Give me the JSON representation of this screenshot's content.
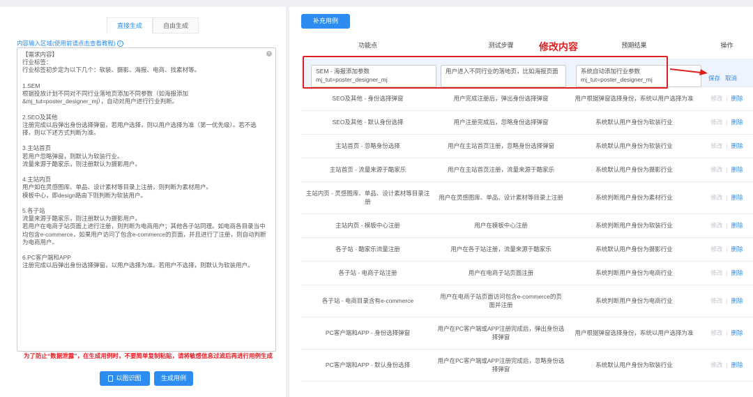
{
  "left": {
    "tabs": [
      "直接生成",
      "自由生成"
    ],
    "hint": "内容输入区域(使用前请点击查看教程)",
    "lines": [
      "【需求内容】",
      "行业标签：",
      "行业标签初步定为以下几个：软装、摄影、海报、电商、找素材等。",
      "",
      "1.SEM",
      "根据投放计划不同对不同行业落地页添加不同参数（如海报添加",
      "&mj_tut=poster_designer_mj），自动对用户进行行业判断。",
      "",
      "2.SEO及其他",
      "注册完成以后弹出身份选择弹窗，若用户选择，则以用户选择为准（第一优先级）。若不选",
      "择，则以下述方式判断为准。",
      "",
      "3.主站首页",
      "若用户忽略弹窗，则默认为软装行业。",
      "流量来源于酷家乐，则注册默认为摄影用户。",
      "",
      "4.主站内页",
      "用户如在灵感图库、单品、设计素材等目录上注册，则判断为素材用户。",
      "模板中心，即design路由下则判断为软装用户。",
      "",
      "5.各子站",
      "流量来源于酷家乐，则注册默认为摄影用户。",
      "若用户在电商子站页面上进行注册，则判断为电商用户；其他各子站同理。如电商各目录当中",
      "均包含e-commerce，如果用户访问了包含e-commerce的页面，并且进行了注册，则自动判断",
      "为电商用户。",
      "",
      "6.PC客户端和APP",
      "注册完成以后弹出身份选择弹窗，以用户选择为准。若用户不选择，则默认为软装用户。"
    ],
    "warning": "为了防止“数据泄露”，在生成用例时，不要简单复制粘贴，请将敏感信息过滤后再进行用例生成",
    "preview_button": "以图识图",
    "generate_button": "生成用例"
  },
  "right": {
    "add_button": "补充用例",
    "headers": [
      "功能点",
      "测试步骤",
      "预期结果",
      "操作"
    ],
    "annotation": "修改内容",
    "edit_row": {
      "feature": "SEM - 海报添加参数 mj_tut=poster_designer_mj",
      "steps": "用户进入不同行业的落地页，比如海报页面",
      "expected": "系统自动添加行业参数 mj_tut=poster_designer_mj",
      "save": "保存",
      "cancel": "取消"
    },
    "op_edit": "修改",
    "op_sep": "|",
    "op_delete": "删除",
    "rows": [
      {
        "feature": "SEO及其他 - 身份选择弹窗",
        "steps": "用户完成注册后，弹出身份选择弹窗",
        "expected": "用户根据弹窗选择身份，系统以用户选择为准"
      },
      {
        "feature": "SEO及其他 - 默认身份选择",
        "steps": "用户注册完成后，忽略身份选择弹窗",
        "expected": "系统默认用户身份为软装行业"
      },
      {
        "feature": "主站首页 - 忽略身份选择",
        "steps": "用户在主站首页注册，忽略身份选择弹窗",
        "expected": "系统默认用户身份为软装行业"
      },
      {
        "feature": "主站首页 - 流量来源于酷家乐",
        "steps": "用户在主站首页注册，流量来源于酷家乐",
        "expected": "系统默认用户身份为摄影行业"
      },
      {
        "feature": "主站内页 - 灵感图库、单品、设计素材等目录注册",
        "steps": "用户在灵感图库、单品、设计素材等目录上注册",
        "expected": "系统判断用户身份为素材行业"
      },
      {
        "feature": "主站内页 - 模板中心注册",
        "steps": "用户在模板中心注册",
        "expected": "系统判断用户身份为软装行业"
      },
      {
        "feature": "各子站 - 酷家乐流量注册",
        "steps": "用户在各子站注册，流量来源于酷家乐",
        "expected": "系统默认用户身份为摄影行业"
      },
      {
        "feature": "各子站 - 电商子站注册",
        "steps": "用户在电商子站页面注册",
        "expected": "系统判断用户身份为电商行业"
      },
      {
        "feature": "各子站 - 电商目录含有e-commerce",
        "steps": "用户在电商子站页面访问包含e-commerce的页面并注册",
        "expected": "系统判断用户身份为电商行业"
      },
      {
        "feature": "PC客户端和APP - 身份选择弹窗",
        "steps": "用户在PC客户端或APP注册完成后，弹出身份选择弹窗",
        "expected": "用户根据弹窗选择身份，系统以用户选择为准"
      },
      {
        "feature": "PC客户端和APP - 默认身份选择",
        "steps": "用户在PC客户端或APP注册完成后，忽略身份选择弹窗",
        "expected": "系统默认用户身份为软装行业"
      }
    ]
  },
  "colors": {
    "accent": "#2d8cf0",
    "annotation": "#e02020"
  }
}
